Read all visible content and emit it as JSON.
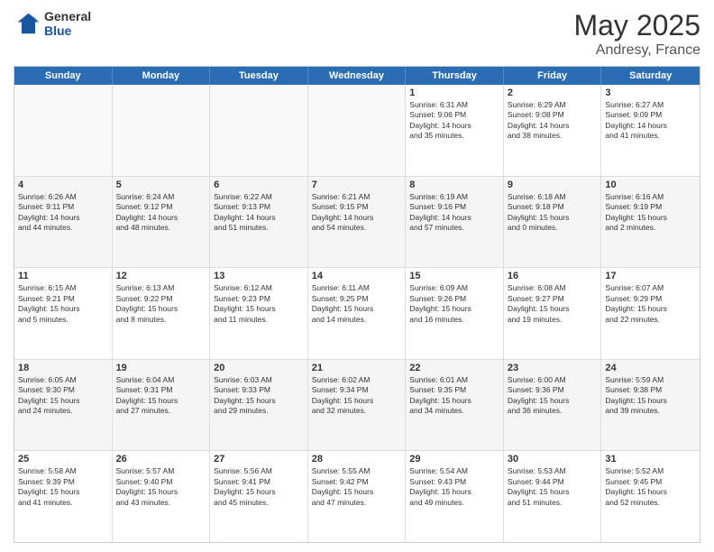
{
  "header": {
    "logo_general": "General",
    "logo_blue": "Blue",
    "title": "May 2025",
    "location": "Andresy, France"
  },
  "days_of_week": [
    "Sunday",
    "Monday",
    "Tuesday",
    "Wednesday",
    "Thursday",
    "Friday",
    "Saturday"
  ],
  "weeks": [
    [
      {
        "day": "",
        "lines": []
      },
      {
        "day": "",
        "lines": []
      },
      {
        "day": "",
        "lines": []
      },
      {
        "day": "",
        "lines": []
      },
      {
        "day": "1",
        "lines": [
          "Sunrise: 6:31 AM",
          "Sunset: 9:06 PM",
          "Daylight: 14 hours",
          "and 35 minutes."
        ]
      },
      {
        "day": "2",
        "lines": [
          "Sunrise: 6:29 AM",
          "Sunset: 9:08 PM",
          "Daylight: 14 hours",
          "and 38 minutes."
        ]
      },
      {
        "day": "3",
        "lines": [
          "Sunrise: 6:27 AM",
          "Sunset: 9:09 PM",
          "Daylight: 14 hours",
          "and 41 minutes."
        ]
      }
    ],
    [
      {
        "day": "4",
        "lines": [
          "Sunrise: 6:26 AM",
          "Sunset: 9:11 PM",
          "Daylight: 14 hours",
          "and 44 minutes."
        ]
      },
      {
        "day": "5",
        "lines": [
          "Sunrise: 6:24 AM",
          "Sunset: 9:12 PM",
          "Daylight: 14 hours",
          "and 48 minutes."
        ]
      },
      {
        "day": "6",
        "lines": [
          "Sunrise: 6:22 AM",
          "Sunset: 9:13 PM",
          "Daylight: 14 hours",
          "and 51 minutes."
        ]
      },
      {
        "day": "7",
        "lines": [
          "Sunrise: 6:21 AM",
          "Sunset: 9:15 PM",
          "Daylight: 14 hours",
          "and 54 minutes."
        ]
      },
      {
        "day": "8",
        "lines": [
          "Sunrise: 6:19 AM",
          "Sunset: 9:16 PM",
          "Daylight: 14 hours",
          "and 57 minutes."
        ]
      },
      {
        "day": "9",
        "lines": [
          "Sunrise: 6:18 AM",
          "Sunset: 9:18 PM",
          "Daylight: 15 hours",
          "and 0 minutes."
        ]
      },
      {
        "day": "10",
        "lines": [
          "Sunrise: 6:16 AM",
          "Sunset: 9:19 PM",
          "Daylight: 15 hours",
          "and 2 minutes."
        ]
      }
    ],
    [
      {
        "day": "11",
        "lines": [
          "Sunrise: 6:15 AM",
          "Sunset: 9:21 PM",
          "Daylight: 15 hours",
          "and 5 minutes."
        ]
      },
      {
        "day": "12",
        "lines": [
          "Sunrise: 6:13 AM",
          "Sunset: 9:22 PM",
          "Daylight: 15 hours",
          "and 8 minutes."
        ]
      },
      {
        "day": "13",
        "lines": [
          "Sunrise: 6:12 AM",
          "Sunset: 9:23 PM",
          "Daylight: 15 hours",
          "and 11 minutes."
        ]
      },
      {
        "day": "14",
        "lines": [
          "Sunrise: 6:11 AM",
          "Sunset: 9:25 PM",
          "Daylight: 15 hours",
          "and 14 minutes."
        ]
      },
      {
        "day": "15",
        "lines": [
          "Sunrise: 6:09 AM",
          "Sunset: 9:26 PM",
          "Daylight: 15 hours",
          "and 16 minutes."
        ]
      },
      {
        "day": "16",
        "lines": [
          "Sunrise: 6:08 AM",
          "Sunset: 9:27 PM",
          "Daylight: 15 hours",
          "and 19 minutes."
        ]
      },
      {
        "day": "17",
        "lines": [
          "Sunrise: 6:07 AM",
          "Sunset: 9:29 PM",
          "Daylight: 15 hours",
          "and 22 minutes."
        ]
      }
    ],
    [
      {
        "day": "18",
        "lines": [
          "Sunrise: 6:05 AM",
          "Sunset: 9:30 PM",
          "Daylight: 15 hours",
          "and 24 minutes."
        ]
      },
      {
        "day": "19",
        "lines": [
          "Sunrise: 6:04 AM",
          "Sunset: 9:31 PM",
          "Daylight: 15 hours",
          "and 27 minutes."
        ]
      },
      {
        "day": "20",
        "lines": [
          "Sunrise: 6:03 AM",
          "Sunset: 9:33 PM",
          "Daylight: 15 hours",
          "and 29 minutes."
        ]
      },
      {
        "day": "21",
        "lines": [
          "Sunrise: 6:02 AM",
          "Sunset: 9:34 PM",
          "Daylight: 15 hours",
          "and 32 minutes."
        ]
      },
      {
        "day": "22",
        "lines": [
          "Sunrise: 6:01 AM",
          "Sunset: 9:35 PM",
          "Daylight: 15 hours",
          "and 34 minutes."
        ]
      },
      {
        "day": "23",
        "lines": [
          "Sunrise: 6:00 AM",
          "Sunset: 9:36 PM",
          "Daylight: 15 hours",
          "and 36 minutes."
        ]
      },
      {
        "day": "24",
        "lines": [
          "Sunrise: 5:59 AM",
          "Sunset: 9:38 PM",
          "Daylight: 15 hours",
          "and 39 minutes."
        ]
      }
    ],
    [
      {
        "day": "25",
        "lines": [
          "Sunrise: 5:58 AM",
          "Sunset: 9:39 PM",
          "Daylight: 15 hours",
          "and 41 minutes."
        ]
      },
      {
        "day": "26",
        "lines": [
          "Sunrise: 5:57 AM",
          "Sunset: 9:40 PM",
          "Daylight: 15 hours",
          "and 43 minutes."
        ]
      },
      {
        "day": "27",
        "lines": [
          "Sunrise: 5:56 AM",
          "Sunset: 9:41 PM",
          "Daylight: 15 hours",
          "and 45 minutes."
        ]
      },
      {
        "day": "28",
        "lines": [
          "Sunrise: 5:55 AM",
          "Sunset: 9:42 PM",
          "Daylight: 15 hours",
          "and 47 minutes."
        ]
      },
      {
        "day": "29",
        "lines": [
          "Sunrise: 5:54 AM",
          "Sunset: 9:43 PM",
          "Daylight: 15 hours",
          "and 49 minutes."
        ]
      },
      {
        "day": "30",
        "lines": [
          "Sunrise: 5:53 AM",
          "Sunset: 9:44 PM",
          "Daylight: 15 hours",
          "and 51 minutes."
        ]
      },
      {
        "day": "31",
        "lines": [
          "Sunrise: 5:52 AM",
          "Sunset: 9:45 PM",
          "Daylight: 15 hours",
          "and 52 minutes."
        ]
      }
    ]
  ]
}
